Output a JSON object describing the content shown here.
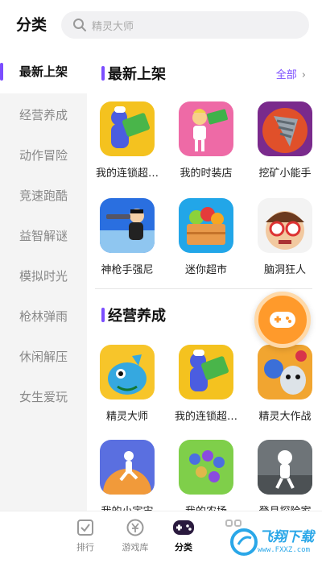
{
  "header": {
    "title": "分类",
    "search_placeholder": "精灵大师"
  },
  "sidebar": {
    "items": [
      {
        "label": "最新上架"
      },
      {
        "label": "经营养成"
      },
      {
        "label": "动作冒险"
      },
      {
        "label": "竞速跑酷"
      },
      {
        "label": "益智解谜"
      },
      {
        "label": "模拟时光"
      },
      {
        "label": "枪林弹雨"
      },
      {
        "label": "休闲解压"
      },
      {
        "label": "女生爱玩"
      }
    ]
  },
  "sections": [
    {
      "title": "最新上架",
      "all_label": "全部",
      "apps": [
        {
          "name": "我的连锁超…",
          "icon": "chain-store-game-icon"
        },
        {
          "name": "我的时装店",
          "icon": "fashion-store-game-icon"
        },
        {
          "name": "挖矿小能手",
          "icon": "mining-drill-game-icon"
        },
        {
          "name": "神枪手强尼",
          "icon": "gunner-game-icon"
        },
        {
          "name": "迷你超市",
          "icon": "mini-market-game-icon"
        },
        {
          "name": "脑洞狂人",
          "icon": "brain-puzzle-game-icon"
        }
      ]
    },
    {
      "title": "经营养成",
      "apps": [
        {
          "name": "精灵大师",
          "icon": "blue-dragon-game-icon"
        },
        {
          "name": "我的连锁超…",
          "icon": "chain-store-game-icon"
        },
        {
          "name": "精灵大作战",
          "icon": "monster-battle-game-icon"
        },
        {
          "name": "我的小宇宙",
          "icon": "planet-runner-game-icon"
        },
        {
          "name": "我的农场",
          "icon": "farm-crowd-game-icon"
        },
        {
          "name": "登月探险家",
          "icon": "moon-explorer-game-icon"
        }
      ]
    }
  ],
  "bottom_nav": [
    {
      "label": "排行",
      "icon": "ranking-icon"
    },
    {
      "label": "游戏库",
      "icon": "game-library-icon"
    },
    {
      "label": "分类",
      "icon": "category-gamepad-icon",
      "active": true
    }
  ],
  "watermark": {
    "text": "飞翔下载",
    "url": "www.FXXZ.com"
  },
  "colors": {
    "accent": "#7b4dff",
    "float_button": "#ff9a2b",
    "watermark": "#2aa7e8"
  }
}
